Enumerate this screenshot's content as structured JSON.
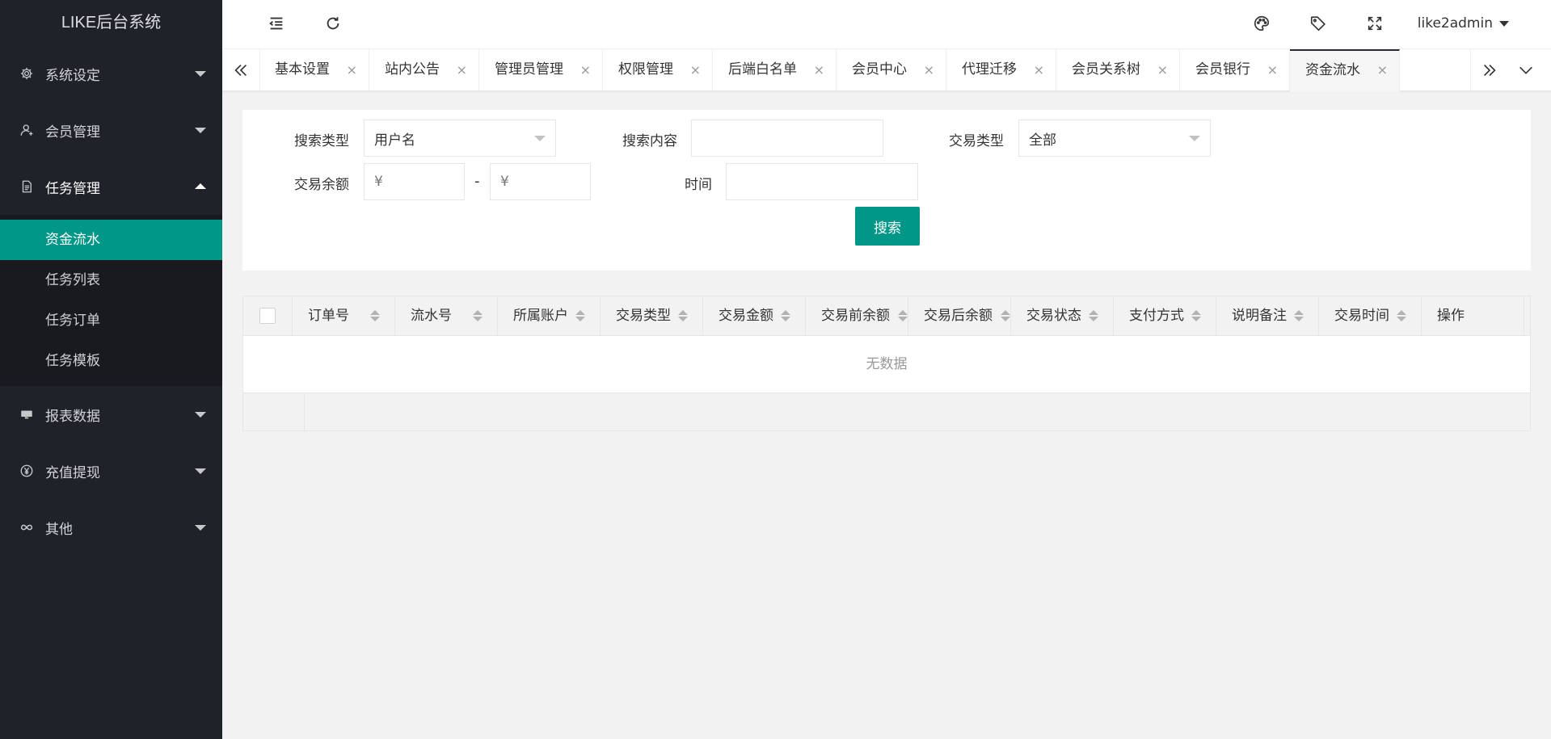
{
  "app": {
    "title": "LIKE后台系统"
  },
  "sidebar": {
    "items": [
      {
        "label": "系统设定",
        "icon": "gear-icon"
      },
      {
        "label": "会员管理",
        "icon": "user-icon"
      },
      {
        "label": "任务管理",
        "icon": "document-icon",
        "expanded": true,
        "children": [
          {
            "label": "资金流水",
            "active": true
          },
          {
            "label": "任务列表"
          },
          {
            "label": "任务订单"
          },
          {
            "label": "任务模板"
          }
        ]
      },
      {
        "label": "报表数据",
        "icon": "monitor-icon"
      },
      {
        "label": "充值提现",
        "icon": "yen-icon"
      },
      {
        "label": "其他",
        "icon": "infinity-icon"
      }
    ]
  },
  "header": {
    "icons": [
      "menu-fold-icon",
      "refresh-icon",
      "palette-icon",
      "tag-icon",
      "fullscreen-icon"
    ],
    "user": "like2admin"
  },
  "tabs": {
    "items": [
      {
        "label": "基本设置"
      },
      {
        "label": "站内公告"
      },
      {
        "label": "管理员管理"
      },
      {
        "label": "权限管理"
      },
      {
        "label": "后端白名单"
      },
      {
        "label": "会员中心"
      },
      {
        "label": "代理迁移"
      },
      {
        "label": "会员关系树"
      },
      {
        "label": "会员银行"
      },
      {
        "label": "资金流水",
        "active": true
      }
    ],
    "close_glyph": "×"
  },
  "search": {
    "type_label": "搜索类型",
    "type_value": "用户名",
    "content_label": "搜索内容",
    "content_value": "",
    "trade_type_label": "交易类型",
    "trade_type_value": "全部",
    "balance_label": "交易余额",
    "balance_min_placeholder": "¥",
    "balance_max_placeholder": "¥",
    "range_separator": "-",
    "time_label": "时间",
    "time_value": "",
    "button_label": "搜索"
  },
  "table": {
    "columns": [
      "订单号",
      "流水号",
      "所属账户",
      "交易类型",
      "交易金额",
      "交易前余额",
      "交易后余额",
      "交易状态",
      "支付方式",
      "说明备注",
      "交易时间",
      "操作"
    ],
    "empty_text": "无数据"
  },
  "colors": {
    "sidebar_bg": "#20222a",
    "submenu_bg": "#181a20",
    "accent": "#009688"
  }
}
